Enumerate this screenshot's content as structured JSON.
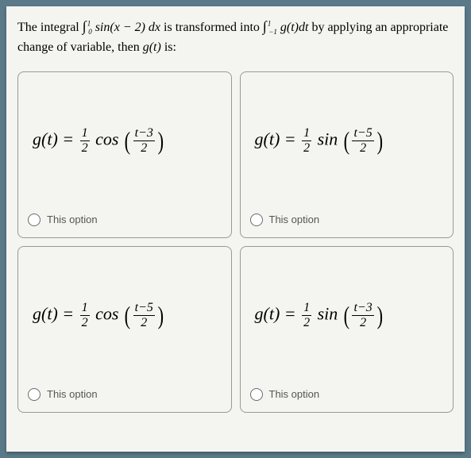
{
  "question": {
    "pre": "The integral ",
    "int1_sym": "∫",
    "int1_lower": "0",
    "int1_upper": "1",
    "int1_body": " sin(x − 2) dx",
    "mid": " is transformed into ",
    "int2_sym": "∫",
    "int2_lower": "−1",
    "int2_upper": "1",
    "int2_body": " g(t)dt",
    "post1": " by applying an appropriate change of variable, then ",
    "gt": "g(t)",
    "post2": " is:"
  },
  "options": [
    {
      "lhs": "g(t) = ",
      "coef_num": "1",
      "coef_den": "2",
      "func": " cos ",
      "arg_num": "t−3",
      "arg_den": "2",
      "label": "This option"
    },
    {
      "lhs": "g(t) = ",
      "coef_num": "1",
      "coef_den": "2",
      "func": " sin ",
      "arg_num": "t−5",
      "arg_den": "2",
      "label": "This option"
    },
    {
      "lhs": "g(t) = ",
      "coef_num": "1",
      "coef_den": "2",
      "func": " cos ",
      "arg_num": "t−5",
      "arg_den": "2",
      "label": "This option"
    },
    {
      "lhs": "g(t) = ",
      "coef_num": "1",
      "coef_den": "2",
      "func": " sin ",
      "arg_num": "t−3",
      "arg_den": "2",
      "label": "This option"
    }
  ]
}
